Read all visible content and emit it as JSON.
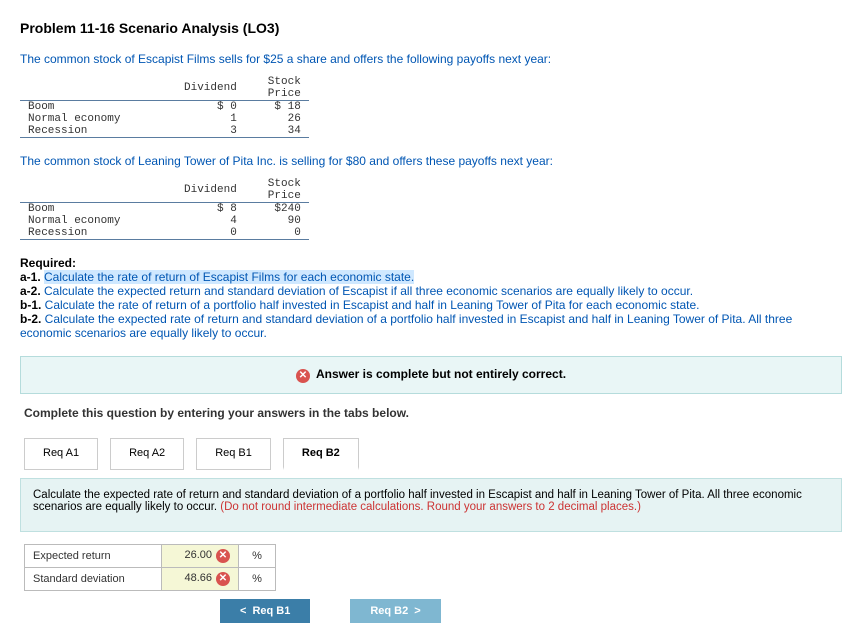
{
  "title": "Problem 11-16 Scenario Analysis (LO3)",
  "intro1": "The common stock of Escapist Films sells for $25 a share and offers the following payoffs next year:",
  "table1": {
    "h1": "Dividend",
    "h2": "Stock Price",
    "rows": [
      {
        "state": "Boom",
        "div": "$ 0",
        "price": "$ 18"
      },
      {
        "state": "Normal economy",
        "div": "1",
        "price": "26"
      },
      {
        "state": "Recession",
        "div": "3",
        "price": "34"
      }
    ]
  },
  "intro2": "The common stock of Leaning Tower of Pita Inc. is selling for $80 and offers these payoffs next year:",
  "table2": {
    "h1": "Dividend",
    "h2": "Stock Price",
    "rows": [
      {
        "state": "Boom",
        "div": "$ 8",
        "price": "$240"
      },
      {
        "state": "Normal economy",
        "div": "4",
        "price": "90"
      },
      {
        "state": "Recession",
        "div": "0",
        "price": "0"
      }
    ]
  },
  "required_label": "Required:",
  "reqs": {
    "a1_tag": "a-1. ",
    "a1": "Calculate the rate of return of Escapist Films for each economic state.",
    "a2_tag": "a-2. ",
    "a2": "Calculate the expected return and standard deviation of Escapist if all three economic scenarios are equally likely to occur.",
    "b1_tag": "b-1. ",
    "b1": "Calculate the rate of return of a portfolio half invested in Escapist and half in Leaning Tower of Pita for each economic state.",
    "b2_tag": "b-2. ",
    "b2": "Calculate the expected rate of return and standard deviation of a portfolio half invested in Escapist and half in Leaning Tower of Pita. All three economic scenarios are equally likely to occur."
  },
  "status_text": "Answer is complete but not entirely correct.",
  "complete_text": "Complete this question by entering your answers in the tabs below.",
  "tabs": {
    "a1": "Req A1",
    "a2": "Req A2",
    "b1": "Req B1",
    "b2": "Req B2"
  },
  "panel": {
    "text": "Calculate the expected rate of return and standard deviation of a portfolio half invested in Escapist and half in Leaning Tower of Pita. All three economic scenarios are equally likely to occur. ",
    "round": "(Do not round intermediate calculations. Round your answers to 2 decimal places.)"
  },
  "results": {
    "r1_label": "Expected return",
    "r1_val": "26.00",
    "r1_unit": "%",
    "r2_label": "Standard deviation",
    "r2_val": "48.66",
    "r2_unit": "%"
  },
  "nav": {
    "prev": "Req B1",
    "next": "Req B2"
  },
  "glyph": {
    "chev_l": "<",
    "chev_r": ">",
    "x": "✕"
  }
}
